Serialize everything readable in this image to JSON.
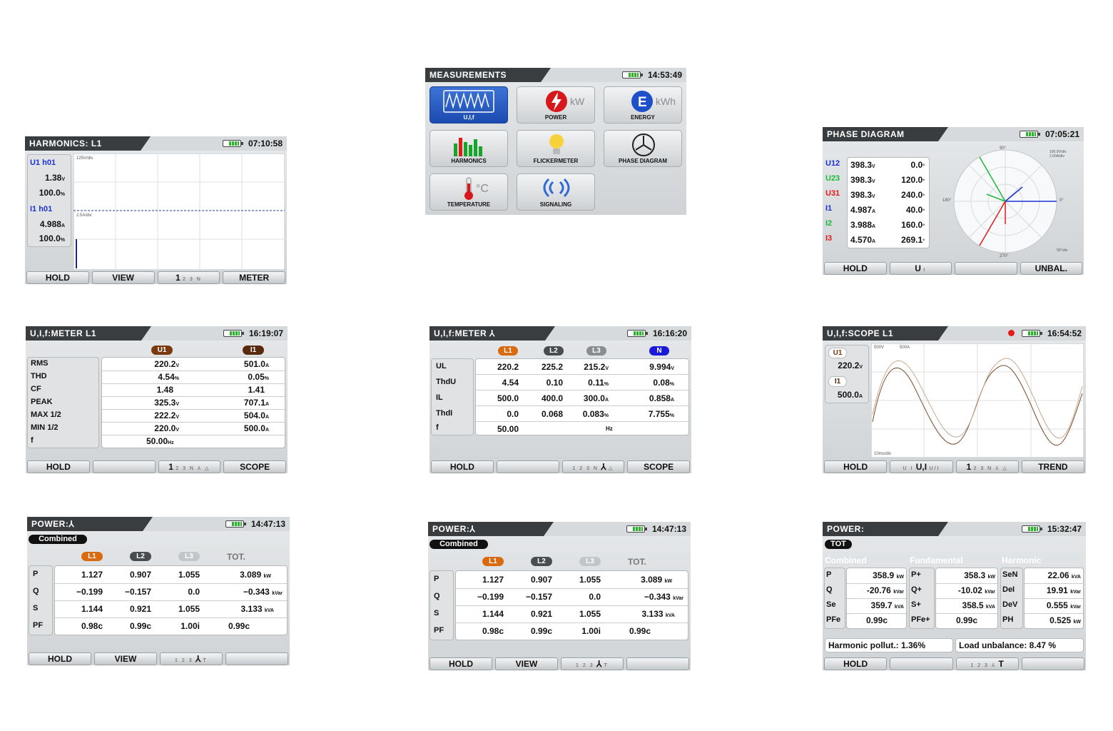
{
  "harmonics": {
    "title": "HARMONICS: L1",
    "time": "07:10:58",
    "u_label": "U1 h01",
    "u_value": "1.38",
    "u_unit": "V",
    "u_pct": "100.0",
    "pct_unit": "%",
    "i_label": "I1 h01",
    "i_value": "4.988",
    "i_unit": "A",
    "i_pct": "100.0",
    "scale_u": "125V/div",
    "scale_i": "2.5A/div",
    "footer": [
      "HOLD",
      "VIEW",
      "1",
      "2 3 N",
      "METER"
    ]
  },
  "measurements": {
    "title": "MEASUREMENTS",
    "time": "14:53:49",
    "tiles": [
      {
        "label": "U,I,f",
        "icon": "waveform-icon"
      },
      {
        "label": "POWER",
        "icon": "power-bolt-icon",
        "unit": "kW"
      },
      {
        "label": "ENERGY",
        "icon": "energy-e-icon",
        "unit": "kWh"
      },
      {
        "label": "HARMONICS",
        "icon": "harmonics-bars-icon"
      },
      {
        "label": "FLICKERMETER",
        "icon": "lightbulb-icon"
      },
      {
        "label": "PHASE DIAGRAM",
        "icon": "phase-diagram-icon"
      },
      {
        "label": "TEMPERATURE",
        "icon": "thermometer-icon",
        "unit": "°C"
      },
      {
        "label": "SIGNALING",
        "icon": "signal-waves-icon"
      }
    ]
  },
  "phase": {
    "title": "PHASE DIAGRAM",
    "time": "07:05:21",
    "rows": [
      {
        "name": "U12",
        "value": "398.3",
        "unit": "V",
        "angle": "0.0",
        "color": "#1a32d8"
      },
      {
        "name": "U23",
        "value": "398.3",
        "unit": "V",
        "angle": "120.0",
        "color": "#19b93a"
      },
      {
        "name": "U31",
        "value": "398.3",
        "unit": "V",
        "angle": "240.0",
        "color": "#e01919"
      },
      {
        "name": "I1",
        "value": "4.987",
        "unit": "A",
        "angle": "40.0",
        "color": "#1a32d8"
      },
      {
        "name": "I2",
        "value": "3.988",
        "unit": "A",
        "angle": "160.0",
        "color": "#19b93a"
      },
      {
        "name": "I3",
        "value": "4.570",
        "unit": "A",
        "angle": "269.1",
        "color": "#e01919"
      }
    ],
    "deg_unit": "°",
    "axis": {
      "top": "90°",
      "left": "180°",
      "right": "0°",
      "bottom": "270°"
    },
    "scale_u": "100.0V/div",
    "scale_i": "2.00A/div",
    "scale_corner": "50°/div",
    "footer": [
      "HOLD",
      "U",
      "I",
      "",
      "UNBAL."
    ]
  },
  "meter_l1": {
    "title": "U,I,f:METER L1",
    "time": "16:19:07",
    "heads": [
      "U1",
      "I1"
    ],
    "rows": [
      {
        "name": "RMS",
        "u": "220.2",
        "uu": "V",
        "i": "501.0",
        "iu": "A"
      },
      {
        "name": "THD",
        "u": "4.54",
        "uu": "%",
        "i": "0.05",
        "iu": "%"
      },
      {
        "name": "CF",
        "u": "1.48",
        "uu": "",
        "i": "1.41",
        "iu": ""
      },
      {
        "name": "PEAK",
        "u": "325.3",
        "uu": "V",
        "i": "707.1",
        "iu": "A"
      },
      {
        "name": "MAX 1/2",
        "u": "222.2",
        "uu": "V",
        "i": "504.0",
        "iu": "A"
      },
      {
        "name": "MIN 1/2",
        "u": "220.0",
        "uu": "V",
        "i": "500.0",
        "iu": "A"
      },
      {
        "name": "f",
        "u": "50.00",
        "uu": "Hz",
        "i": "",
        "iu": ""
      }
    ],
    "footer": [
      "HOLD",
      "",
      "1",
      "2 3 N ⅄ △",
      "SCOPE"
    ]
  },
  "meter_3p": {
    "title": "U,I,f:METER ⅄",
    "time": "16:16:20",
    "heads": [
      "L1",
      "L2",
      "L3",
      "N"
    ],
    "rows": [
      {
        "name": "UL",
        "v": [
          "220.2",
          "225.2",
          "215.2",
          "9.994"
        ],
        "unit": "V"
      },
      {
        "name": "ThdU",
        "v": [
          "4.54",
          "0.10",
          "0.11",
          "0.08"
        ],
        "unit": "%"
      },
      {
        "name": "IL",
        "v": [
          "500.0",
          "400.0",
          "300.0",
          "0.858"
        ],
        "unit": "A"
      },
      {
        "name": "ThdI",
        "v": [
          "0.0",
          "0.068",
          "0.083",
          "7.755"
        ],
        "unit": "%"
      },
      {
        "name": "f",
        "v": [
          "50.00",
          "",
          "",
          ""
        ],
        "unit": "Hz"
      }
    ],
    "footer": [
      "HOLD",
      "",
      "1 2 3 N",
      "⅄",
      "△",
      "SCOPE"
    ]
  },
  "scope": {
    "title": "U,I,f:SCOPE L1",
    "time": "16:54:52",
    "u_label": "U1",
    "u_value": "220.2",
    "u_unit": "V",
    "i_label": "I1",
    "i_value": "500.0",
    "i_unit": "A",
    "scale_u": "500V",
    "scale_i": "500A",
    "scale_t": "10ms/div",
    "footer": [
      "HOLD",
      "U I",
      "U,I",
      "U/I",
      "1",
      "2 3 N ⅄ △",
      "TREND"
    ]
  },
  "power1": {
    "title": "POWER:⅄",
    "time": "14:47:13",
    "badge": "Combined",
    "heads": [
      "L1",
      "L2",
      "L3",
      "TOT."
    ],
    "rows": [
      {
        "name": "P",
        "v": [
          "1.127",
          "0.907",
          "1.055",
          "3.089"
        ],
        "unit": "kW"
      },
      {
        "name": "Q",
        "v": [
          "−0.199",
          "−0.157",
          "0.0",
          "−0.343"
        ],
        "unit": "kVar"
      },
      {
        "name": "S",
        "v": [
          "1.144",
          "0.921",
          "1.055",
          "3.133"
        ],
        "unit": "kVA"
      },
      {
        "name": "PF",
        "v": [
          "0.98c",
          "0.99c",
          "1.00i",
          "0.99c"
        ],
        "unit": ""
      }
    ],
    "footer": [
      "HOLD",
      "VIEW",
      "1 2 3",
      "⅄",
      "T",
      ""
    ]
  },
  "power2": {
    "title": "POWER:⅄",
    "time": "14:47:13",
    "badge": "Combined",
    "heads": [
      "L1",
      "L2",
      "L3",
      "TOT."
    ],
    "rows": [
      {
        "name": "P",
        "v": [
          "1.127",
          "0.907",
          "1.055",
          "3.089"
        ],
        "unit": "kW"
      },
      {
        "name": "Q",
        "v": [
          "−0.199",
          "−0.157",
          "0.0",
          "−0.343"
        ],
        "unit": "kVar"
      },
      {
        "name": "S",
        "v": [
          "1.144",
          "0.921",
          "1.055",
          "3.133"
        ],
        "unit": "kVA"
      },
      {
        "name": "PF",
        "v": [
          "0.98c",
          "0.99c",
          "1.00i",
          "0.99c"
        ],
        "unit": ""
      }
    ],
    "footer": [
      "HOLD",
      "VIEW",
      "1 2 3",
      "⅄",
      "T",
      ""
    ]
  },
  "power_tot": {
    "title": "POWER:",
    "time": "15:32:47",
    "badge": "TOT",
    "groups": [
      "Combined",
      "Fundamental",
      "Harmonic"
    ],
    "combined": [
      {
        "name": "P",
        "value": "358.9",
        "unit": "kW"
      },
      {
        "name": "Q",
        "value": "-20.76",
        "unit": "kVar"
      },
      {
        "name": "Se",
        "value": "359.7",
        "unit": "kVA"
      },
      {
        "name": "PFe",
        "value": "0.99c",
        "unit": ""
      }
    ],
    "fundamental": [
      {
        "name": "P+",
        "value": "358.3",
        "unit": "kW"
      },
      {
        "name": "Q+",
        "value": "-10.02",
        "unit": "kVar"
      },
      {
        "name": "S+",
        "value": "358.5",
        "unit": "kVA"
      },
      {
        "name": "PFe+",
        "value": "0.99c",
        "unit": ""
      }
    ],
    "harmonic": [
      {
        "name": "SeN",
        "value": "22.06",
        "unit": "kVA"
      },
      {
        "name": "DeI",
        "value": "19.91",
        "unit": "kVar"
      },
      {
        "name": "DeV",
        "value": "0.555",
        "unit": "kVar"
      },
      {
        "name": "PH",
        "value": "0.525",
        "unit": "kW"
      }
    ],
    "pollution": "Harmonic pollut.: 1.36%",
    "unbalance": "Load unbalance: 8.47 %",
    "footer": [
      "HOLD",
      "",
      "1 2 3 ⅄",
      "T",
      ""
    ]
  }
}
